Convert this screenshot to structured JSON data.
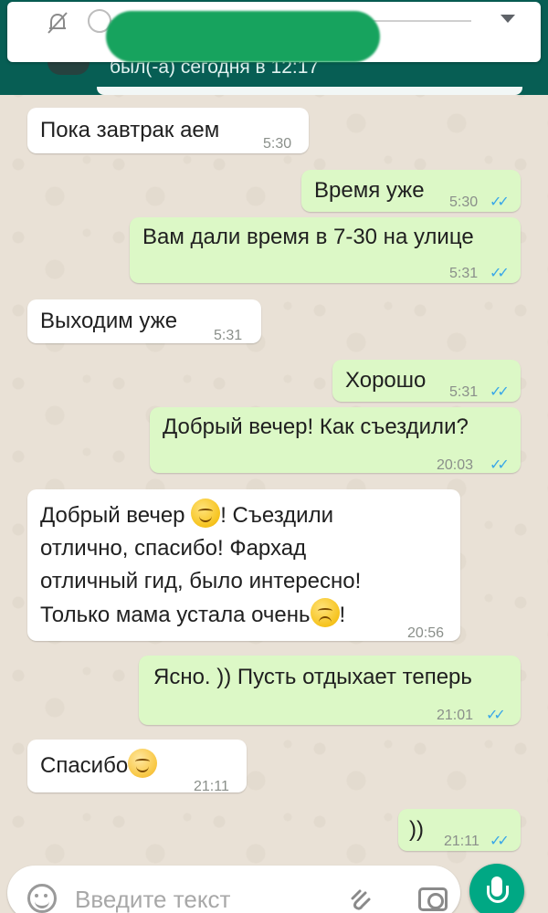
{
  "header": {
    "last_seen": "был(-а) сегодня в 12:17"
  },
  "messages": [
    {
      "dir": "in",
      "text": "Пока завтрак аем",
      "time": "5:30"
    },
    {
      "dir": "out",
      "text": "Время уже",
      "time": "5:30",
      "ticks": "✓✓"
    },
    {
      "dir": "out",
      "text": "Вам дали время в 7-30 на улице",
      "time": "5:31",
      "ticks": "✓✓"
    },
    {
      "dir": "in",
      "text": "Выходим уже",
      "time": "5:31"
    },
    {
      "dir": "out",
      "text": "Хорошо",
      "time": "5:31",
      "ticks": "✓✓"
    },
    {
      "dir": "out",
      "text": "Добрый вечер! Как съездили?",
      "time": "20:03",
      "ticks": "✓✓"
    },
    {
      "dir": "in",
      "time": "20:56",
      "lines": [
        "Добрый вечер",
        "! Съездили",
        "отлично, спасибо! Фархад",
        "отличный гид, было интересно!",
        "Только мама устала очень",
        "!"
      ],
      "emojis": [
        "smiling-face-emoji",
        "disappointed-face-emoji"
      ]
    },
    {
      "dir": "out",
      "text": "Ясно. )) Пусть отдыхает теперь",
      "time": "21:01",
      "ticks": "✓✓"
    },
    {
      "dir": "in",
      "text": "Спасибо",
      "time": "21:11",
      "emoji": "blushing-face-emoji"
    },
    {
      "dir": "out",
      "text": "))",
      "time": "21:11",
      "ticks": "✓✓"
    }
  ],
  "composer": {
    "placeholder": "Введите текст",
    "icons": [
      "emoji-icon",
      "attach-icon",
      "camera-icon",
      "mic-icon"
    ]
  },
  "colors": {
    "header": "#075e54",
    "outgoing_bubble": "#dcf8c6",
    "incoming_bubble": "#ffffff",
    "read_ticks": "#3aa7e8",
    "mic_button": "#00a884"
  }
}
